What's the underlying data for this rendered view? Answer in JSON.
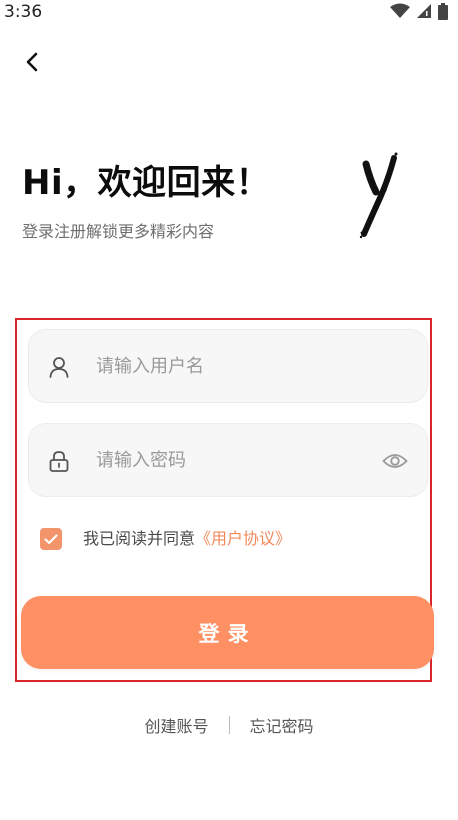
{
  "status_bar": {
    "time": "3:36",
    "icons": [
      "wifi-icon",
      "signal-icon",
      "battery-icon"
    ]
  },
  "nav": {
    "back_icon": "chevron-left-icon"
  },
  "header": {
    "title": "Hi，欢迎回来！",
    "subtitle": "登录注册解锁更多精彩内容",
    "logo_text": "Y"
  },
  "form": {
    "username": {
      "placeholder": "请输入用户名",
      "value": "",
      "icon": "user-icon"
    },
    "password": {
      "placeholder": "请输入密码",
      "value": "",
      "icon": "lock-icon",
      "toggle_icon": "eye-icon"
    },
    "agreement": {
      "checked": true,
      "text": "我已阅读并同意",
      "link_text": "《用户协议》"
    },
    "login_label": "登录"
  },
  "footer": {
    "register_label": "创建账号",
    "forgot_label": "忘记密码"
  },
  "colors": {
    "accent": "#fe9063",
    "link": "#f08a5d",
    "highlight_border": "#d8262a"
  }
}
